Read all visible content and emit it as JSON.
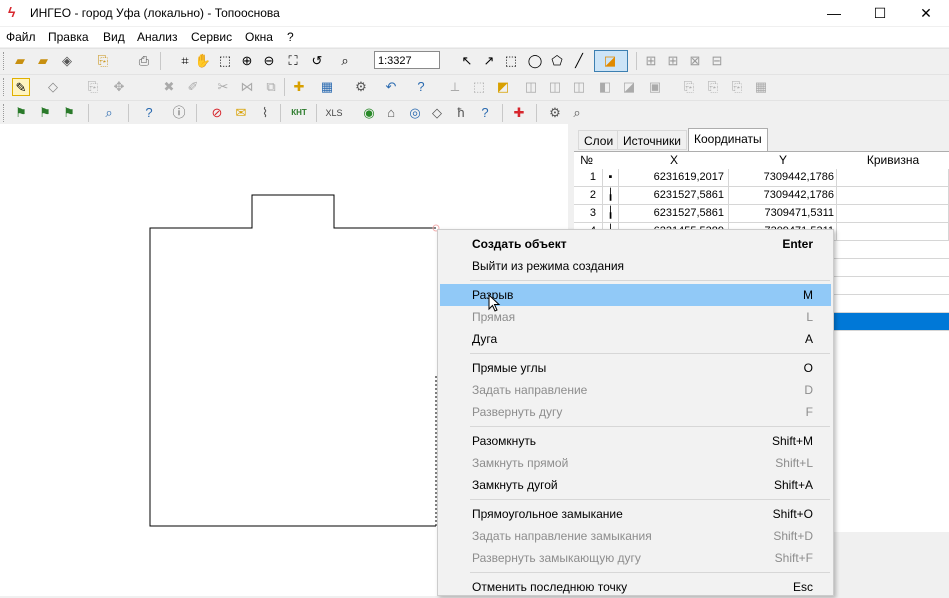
{
  "window": {
    "title": "ИНГЕО - город Уфа (локально) - Топооснова",
    "minimize": "—",
    "maximize": "☐",
    "close": "✕"
  },
  "menu": [
    "Файл",
    "Правка",
    "Вид",
    "Анализ",
    "Сервис",
    "Окна",
    "?"
  ],
  "toolbar": {
    "scale": "1:3327",
    "xls_label": "XLS",
    "knt_label": "КНТ"
  },
  "panel": {
    "tabs": [
      "Слои",
      "Источники",
      "Координаты"
    ],
    "active_tab": "Координаты",
    "columns": [
      "№",
      "X",
      "Y",
      "Кривизна"
    ],
    "rows": [
      {
        "n": "1",
        "x": "6231619,2017",
        "y": "7309442,1786"
      },
      {
        "n": "2",
        "x": "6231527,5861",
        "y": "7309442,1786"
      },
      {
        "n": "3",
        "x": "6231527,5861",
        "y": "7309471,5311"
      },
      {
        "n": "4",
        "x": "6231455,5389",
        "y": "7309471,5311"
      }
    ]
  },
  "context_menu": [
    {
      "label": "Создать объект",
      "key": "Enter",
      "state": "bold"
    },
    {
      "label": "Выйти из режима создания",
      "key": "",
      "state": "normal"
    },
    {
      "sep": true
    },
    {
      "label": "Разрыв",
      "key": "M",
      "state": "highlighted"
    },
    {
      "label": "Прямая",
      "key": "L",
      "state": "disabled"
    },
    {
      "label": "Дуга",
      "key": "A",
      "state": "normal"
    },
    {
      "sep": true
    },
    {
      "label": "Прямые углы",
      "key": "O",
      "state": "normal"
    },
    {
      "label": "Задать направление",
      "key": "D",
      "state": "disabled"
    },
    {
      "label": "Развернуть дугу",
      "key": "F",
      "state": "disabled"
    },
    {
      "sep": true
    },
    {
      "label": "Разомкнуть",
      "key": "Shift+M",
      "state": "normal"
    },
    {
      "label": "Замкнуть прямой",
      "key": "Shift+L",
      "state": "disabled"
    },
    {
      "label": "Замкнуть дугой",
      "key": "Shift+A",
      "state": "normal"
    },
    {
      "sep": true
    },
    {
      "label": "Прямоугольное замыкание",
      "key": "Shift+O",
      "state": "normal"
    },
    {
      "label": "Задать направление замыкания",
      "key": "Shift+D",
      "state": "disabled"
    },
    {
      "label": "Развернуть замыкающую дугу",
      "key": "Shift+F",
      "state": "disabled"
    },
    {
      "sep": true
    },
    {
      "label": "Отменить последнюю точку",
      "key": "Esc",
      "state": "normal"
    }
  ],
  "colors": {
    "highlight": "#91c9f7",
    "selection_row": "#0078d7",
    "app_icon": "#d7262d"
  }
}
